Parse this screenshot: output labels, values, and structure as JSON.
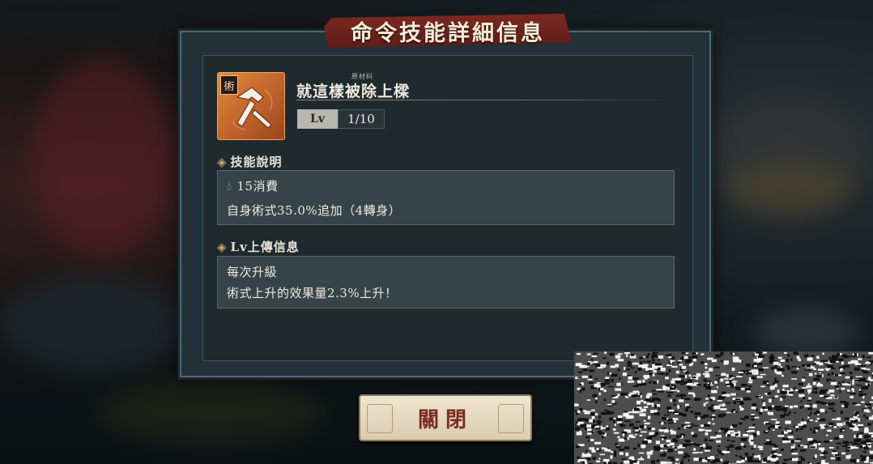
{
  "dialog": {
    "title": "命令技能詳細信息",
    "skill": {
      "icon_tag": "術",
      "icon_name": "hammer-icon",
      "ruby": "原材料",
      "name": "就這樣被除上樑",
      "level_label": "Lv",
      "level_value": "1/10"
    },
    "skill_description": {
      "heading": "技能說明",
      "cost_icon": "drop-icon",
      "cost": "15消費",
      "effect": "自身術式35.0%追加（4轉身）"
    },
    "level_up_info": {
      "heading": "Lv上傳信息",
      "line1": "每次升級",
      "line2": "術式上升的效果量2.3%上升！"
    },
    "close_button": "關閉"
  },
  "colors": {
    "banner": "#6e241d",
    "panel": "#1f2a2f",
    "frame": "#233138",
    "desc_box": "#36444a",
    "icon_orange": "#d0702e",
    "button": "#e6dcc4",
    "button_text": "#7a2a22",
    "accent_drop": "#57c8e0"
  }
}
